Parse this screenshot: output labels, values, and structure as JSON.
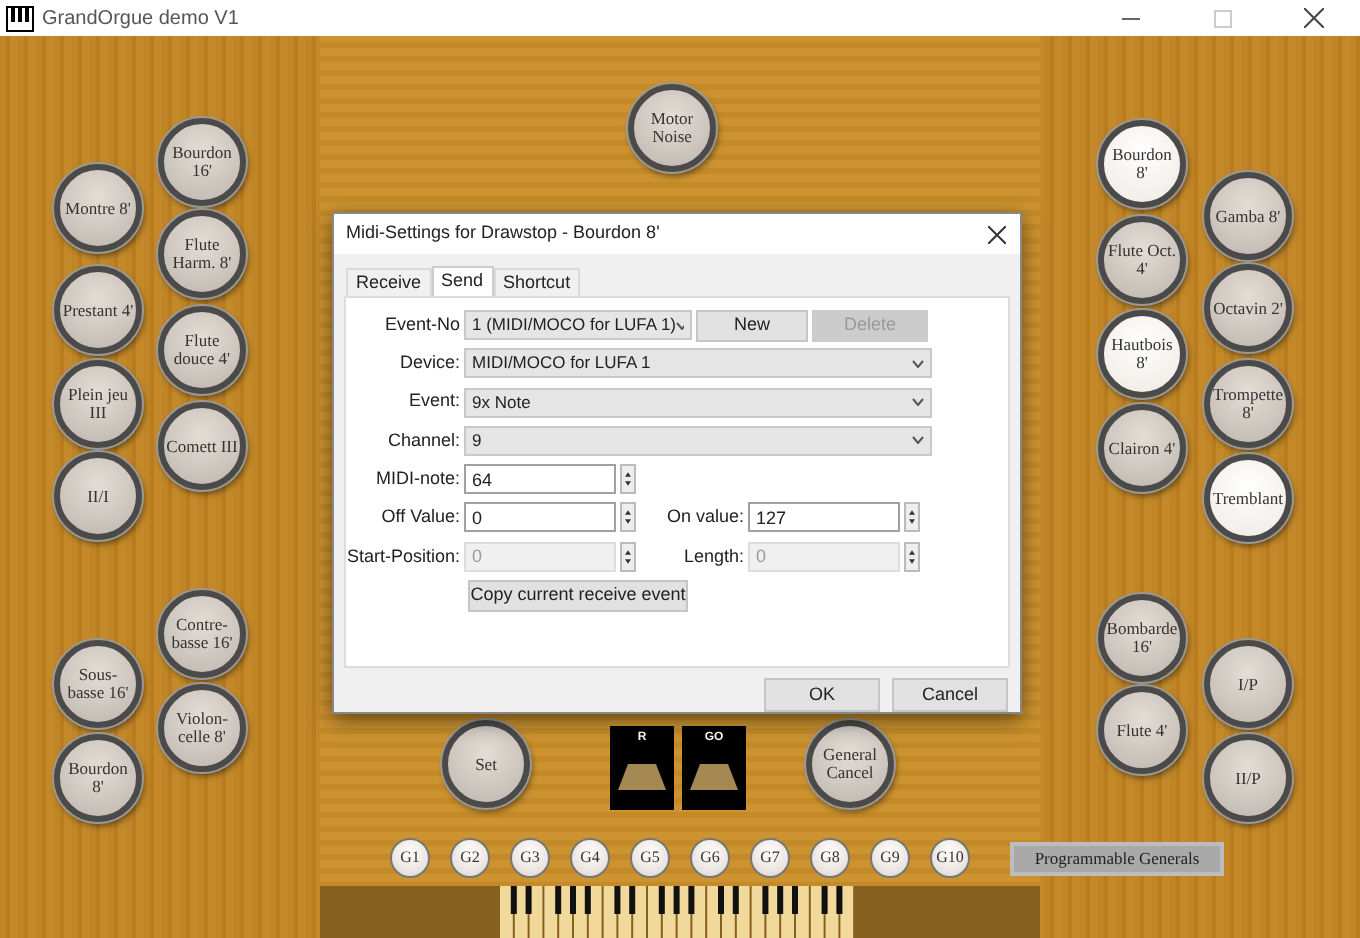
{
  "window": {
    "title": "GrandOrgue demo V1"
  },
  "console": {
    "left_jamb": [
      {
        "label": "Bourdon 16'",
        "engaged": false
      },
      {
        "label": "Montre 8'",
        "engaged": false
      },
      {
        "label": "Flute Harm. 8'",
        "engaged": false
      },
      {
        "label": "Prestant 4'",
        "engaged": false
      },
      {
        "label": "Flute douce 4'",
        "engaged": false
      },
      {
        "label": "Plein jeu III",
        "engaged": false
      },
      {
        "label": "Comett III",
        "engaged": false
      },
      {
        "label": "II/I",
        "engaged": false
      },
      {
        "label": "Contre-basse 16'",
        "engaged": false
      },
      {
        "label": "Sous-basse 16'",
        "engaged": false
      },
      {
        "label": "Violon-celle 8'",
        "engaged": false
      },
      {
        "label": "Bourdon 8'",
        "engaged": false
      }
    ],
    "right_jamb": [
      {
        "label": "Bourdon 8'",
        "engaged": true
      },
      {
        "label": "Gamba 8'",
        "engaged": false
      },
      {
        "label": "Flute Oct. 4'",
        "engaged": false
      },
      {
        "label": "Octavin 2'",
        "engaged": false
      },
      {
        "label": "Hautbois 8'",
        "engaged": true
      },
      {
        "label": "Trompette 8'",
        "engaged": false
      },
      {
        "label": "Clairon 4'",
        "engaged": false
      },
      {
        "label": "Tremblant",
        "engaged": true
      },
      {
        "label": "Bombarde 16'",
        "engaged": false
      },
      {
        "label": "I/P",
        "engaged": false
      },
      {
        "label": "Flute 4'",
        "engaged": false
      },
      {
        "label": "II/P",
        "engaged": false
      }
    ],
    "center": [
      {
        "label": "Motor Noise",
        "engaged": false
      },
      {
        "label": "Set",
        "engaged": false
      },
      {
        "label": "General Cancel",
        "engaged": false
      }
    ],
    "swell_pedals": [
      {
        "label": "R"
      },
      {
        "label": "GO"
      }
    ],
    "generals": [
      {
        "label": "G1"
      },
      {
        "label": "G2"
      },
      {
        "label": "G3"
      },
      {
        "label": "G4"
      },
      {
        "label": "G5"
      },
      {
        "label": "G6"
      },
      {
        "label": "G7"
      },
      {
        "label": "G8"
      },
      {
        "label": "G9"
      },
      {
        "label": "G10"
      }
    ],
    "generals_button": "Programmable Generals"
  },
  "dialog": {
    "title": "Midi-Settings for Drawstop - Bourdon 8'",
    "tabs": [
      {
        "label": "Receive",
        "selected": false
      },
      {
        "label": "Send",
        "selected": true
      },
      {
        "label": "Shortcut",
        "selected": false
      }
    ],
    "event_no": {
      "label": "Event-No",
      "value": "1 (MIDI/MOCO for LUFA 1)"
    },
    "new_button": {
      "label": "New",
      "disabled": false
    },
    "delete_button": {
      "label": "Delete",
      "disabled": true
    },
    "device": {
      "label": "Device:",
      "value": "MIDI/MOCO for LUFA 1"
    },
    "event": {
      "label": "Event:",
      "value": "9x Note"
    },
    "channel": {
      "label": "Channel:",
      "value": "9"
    },
    "midi_note": {
      "label": "MIDI-note:",
      "value": "64",
      "disabled": false
    },
    "off_value": {
      "label": "Off Value:",
      "value": "0",
      "disabled": false
    },
    "on_value": {
      "label": "On value:",
      "value": "127",
      "disabled": false
    },
    "start_position": {
      "label": "Start-Position:",
      "value": "0",
      "disabled": true
    },
    "length": {
      "label": "Length:",
      "value": "0",
      "disabled": true
    },
    "copy_button": {
      "label": "Copy current receive event",
      "disabled": false
    },
    "buttons": [
      {
        "label": "OK"
      },
      {
        "label": "Cancel"
      }
    ]
  }
}
